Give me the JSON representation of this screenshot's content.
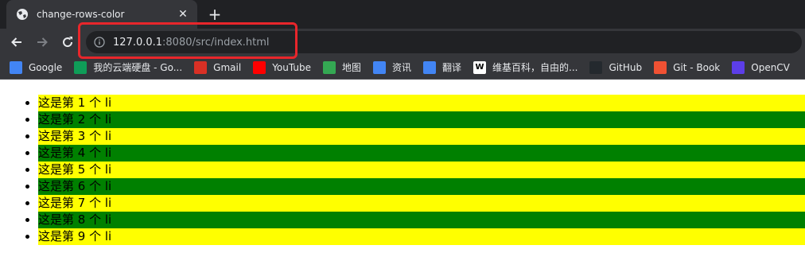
{
  "tab": {
    "title": "change-rows-color",
    "close_glyph": "✕"
  },
  "newtab_glyph": "+",
  "address": {
    "host": "127.0.0.1",
    "rest": ":8080/src/index.html"
  },
  "bookmarks": [
    {
      "label": "Google",
      "icon": "google-icon",
      "color": "#4285f4"
    },
    {
      "label": "我的云端硬盘 - Go...",
      "icon": "google-drive-icon",
      "color": "#0f9d58"
    },
    {
      "label": "Gmail",
      "icon": "gmail-icon",
      "color": "#d93025"
    },
    {
      "label": "YouTube",
      "icon": "youtube-icon",
      "color": "#ff0000"
    },
    {
      "label": "地图",
      "icon": "maps-icon",
      "color": "#34a853"
    },
    {
      "label": "资讯",
      "icon": "news-icon",
      "color": "#4285f4"
    },
    {
      "label": "翻译",
      "icon": "translate-icon",
      "color": "#4285f4"
    },
    {
      "label": "维基百科，自由的...",
      "icon": "wikipedia-icon",
      "color": "#ffffff"
    },
    {
      "label": "GitHub",
      "icon": "github-icon",
      "color": "#24292e"
    },
    {
      "label": "Git - Book",
      "icon": "git-icon",
      "color": "#f05133"
    },
    {
      "label": "OpenCV",
      "icon": "opencv-icon",
      "color": "#5c3ee8"
    }
  ],
  "list": {
    "odd_color": "#ffff00",
    "even_color": "#008000",
    "items": [
      "这是第 1 个 li",
      "这是第 2 个 li",
      "这是第 3 个 li",
      "这是第 4 个 li",
      "这是第 5 个 li",
      "这是第 6 个 li",
      "这是第 7 个 li",
      "这是第 8 个 li",
      "这是第 9 个 li"
    ]
  }
}
